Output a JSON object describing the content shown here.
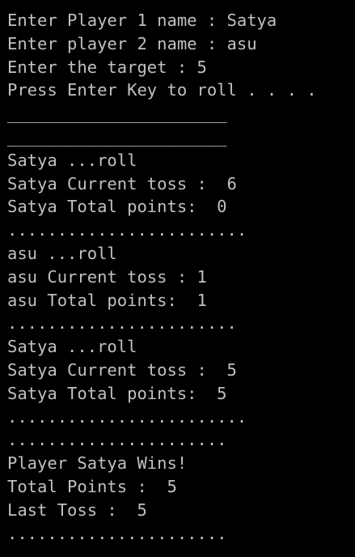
{
  "console": {
    "text_color": "#c0c0c0",
    "background_color": "#000000",
    "lines": [
      "Enter Player 1 name : Satya",
      "Enter player 2 name : asu",
      "Enter the target : 5",
      "Press Enter Key to roll . . . .",
      "______________________",
      "______________________",
      "Satya ...roll",
      "Satya Current toss :  6",
      "Satya Total points:  0",
      "........................",
      "asu ...roll",
      "asu Current toss : 1",
      "asu Total points:  1",
      ".......................",
      "Satya ...roll",
      "Satya Current toss :  5",
      "Satya Total points:  5",
      "........................",
      "......................",
      "Player Satya Wins!",
      "Total Points :  5",
      "Last Toss :  5",
      "......................"
    ]
  }
}
